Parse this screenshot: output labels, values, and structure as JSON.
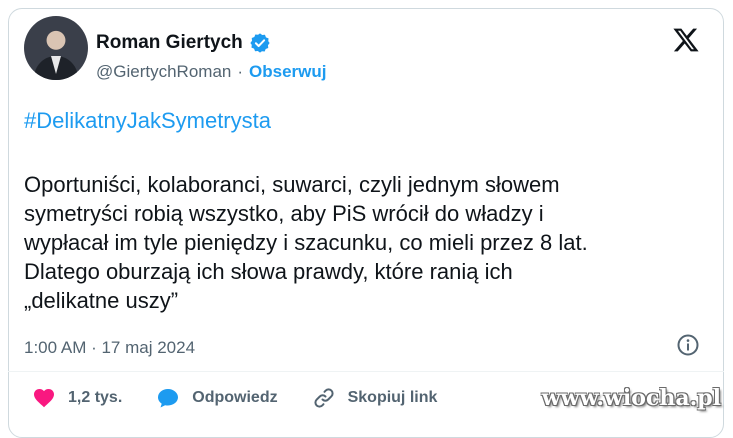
{
  "tweet": {
    "author_name": "Roman Giertych",
    "author_handle": "@GiertychRoman",
    "separator": "·",
    "follow_label": "Obserwuj",
    "hashtag": "#DelikatnyJakSymetrysta",
    "body": "Oportuniści, kolaboranci, suwarci, czyli jednym słowem\nsymetryści robią wszystko, aby PiS wrócił do władzy i\nwypłacał im tyle pieniędzy i szacunku, co mieli przez 8 lat.\nDlatego oburzają ich słowa prawdy, które ranią ich\n„delikatne uszy”",
    "timestamp": "1:00 AM · 17 maj 2024"
  },
  "actions": {
    "like_count": "1,2 tys.",
    "reply_label": "Odpowiedz",
    "copy_label": "Skopiuj link"
  },
  "watermark": "www.wiocha.pl",
  "icons": {
    "verified": "verified-badge-icon",
    "brand": "x-logo-icon",
    "info": "info-icon",
    "like": "heart-icon",
    "reply": "speech-bubble-icon",
    "copy": "link-icon"
  },
  "colors": {
    "accent": "#1d9bf0",
    "like": "#f91880",
    "text": "#0f1419",
    "muted": "#536471",
    "border": "#cfd9de"
  }
}
